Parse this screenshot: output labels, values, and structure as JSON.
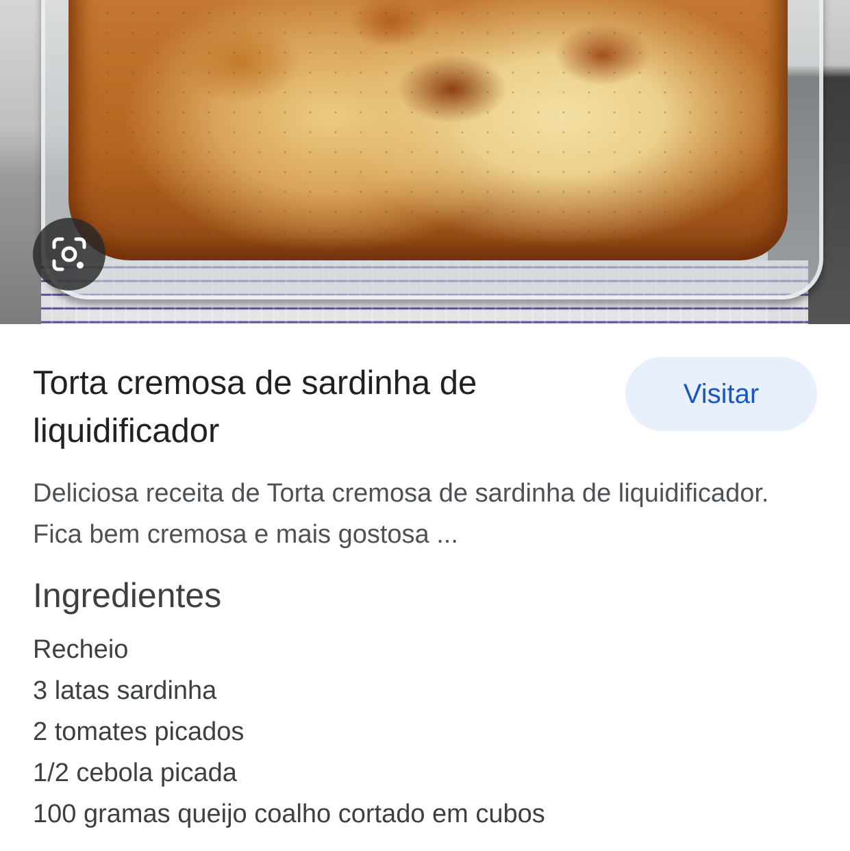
{
  "recipe": {
    "title": "Torta cremosa de sardinha de liquidificador",
    "visit_label": "Visitar",
    "description": "Deliciosa receita de Torta cremosa de sardinha de liquidificador. Fica bem cremosa e mais gostosa ...",
    "ingredients_heading": "Ingredientes",
    "ingredients": [
      "Recheio",
      "3 latas sardinha",
      "2 tomates picados",
      "1/2 cebola picada",
      "100 gramas queijo coalho cortado em cubos"
    ]
  },
  "icons": {
    "lens": "google-lens-icon"
  },
  "colors": {
    "visit_button_bg": "#e8f0fe",
    "visit_button_text": "#1a55c4",
    "title_text": "#202124",
    "body_text": "#4d5156"
  }
}
